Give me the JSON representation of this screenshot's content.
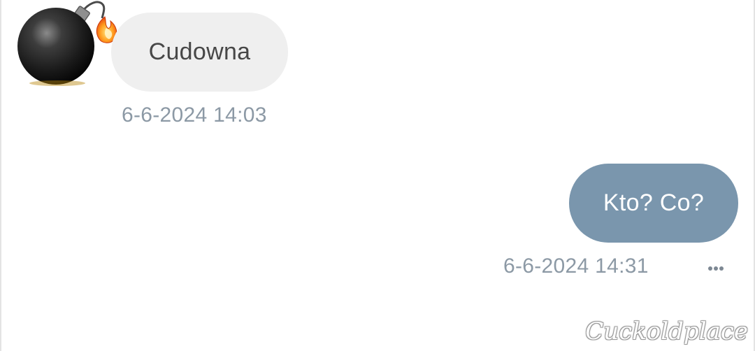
{
  "conversation": {
    "received": {
      "avatar_icon": "bomb-icon",
      "text": "Cudowna",
      "timestamp": "6-6-2024 14:03"
    },
    "sent": {
      "text": "Kto? Co?",
      "timestamp": "6-6-2024 14:31",
      "options_icon": "more-dots-icon"
    }
  },
  "watermark": "Cuckoldplace",
  "colors": {
    "received_bubble": "#efefef",
    "received_text": "#474747",
    "sent_bubble": "#7a96ad",
    "sent_text": "#ffffff",
    "timestamp": "#8c99a5"
  }
}
